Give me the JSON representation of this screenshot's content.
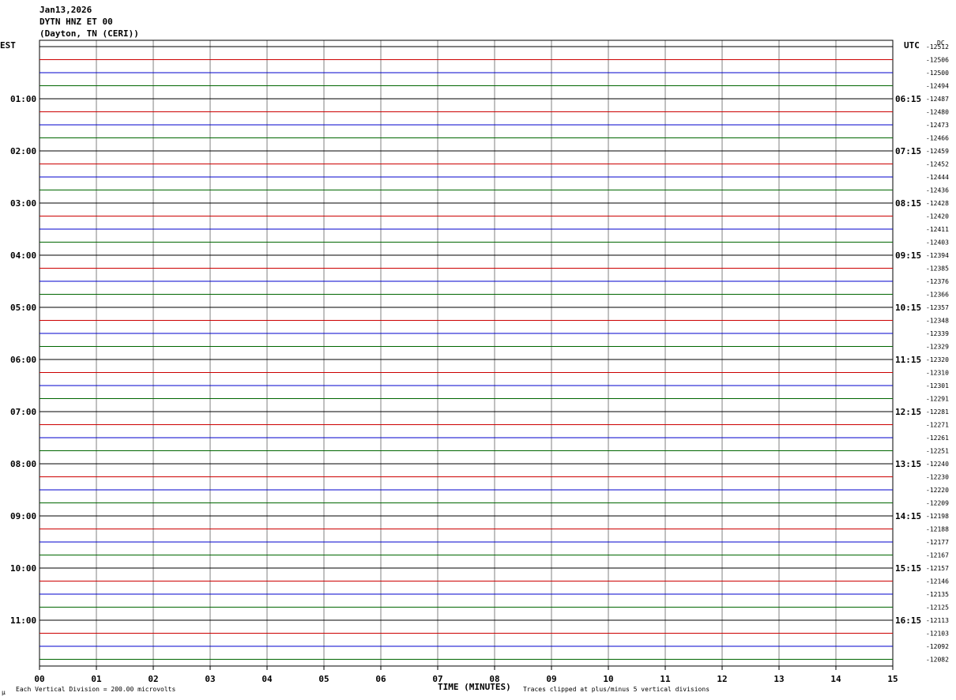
{
  "header": {
    "date": "Jan13,2026",
    "station": "DYTN HNZ ET 00",
    "location": "(Dayton, TN (CERI))"
  },
  "left_timezone": "EST",
  "right_timezone": "UTC",
  "dc_header": "DC",
  "footer": {
    "scale": "Each Vertical Division =  200.00 microvolts",
    "clip": "Traces clipped at plus/minus 5 vertical divisions",
    "corner_mark": "µ"
  },
  "colors": {
    "line_cycle": [
      "#000000",
      "#cc0000",
      "#0000cc",
      "#006600"
    ],
    "grid": "#808080",
    "frame": "#000000"
  },
  "chart_data": {
    "type": "line",
    "title": "DYTN HNZ ET 00",
    "xlabel": "TIME (MINUTES)",
    "ylabel": "",
    "xlim": [
      0,
      15
    ],
    "x_ticks": [
      "00",
      "01",
      "02",
      "03",
      "04",
      "05",
      "06",
      "07",
      "08",
      "09",
      "10",
      "11",
      "12",
      "13",
      "14",
      "15"
    ],
    "grid": true,
    "trace_count": 48,
    "left_hour_labels": [
      "01:00",
      "02:00",
      "03:00",
      "04:00",
      "05:00",
      "06:00",
      "07:00",
      "08:00",
      "09:00",
      "10:00",
      "11:00"
    ],
    "right_hour_labels": [
      "06:15",
      "07:15",
      "08:15",
      "09:15",
      "10:15",
      "11:15",
      "12:15",
      "13:15",
      "14:15",
      "15:15",
      "16:15"
    ],
    "dc_offsets": [
      -12512,
      -12506,
      -12500,
      -12494,
      -12487,
      -12480,
      -12473,
      -12466,
      -12459,
      -12452,
      -12444,
      -12436,
      -12428,
      -12420,
      -12411,
      -12403,
      -12394,
      -12385,
      -12376,
      -12366,
      -12357,
      -12348,
      -12339,
      -12329,
      -12320,
      -12310,
      -12301,
      -12291,
      -12281,
      -12271,
      -12261,
      -12251,
      -12240,
      -12230,
      -12220,
      -12209,
      -12198,
      -12188,
      -12177,
      -12167,
      -12157,
      -12146,
      -12135,
      -12125,
      -12113,
      -12103,
      -12092,
      -12082
    ]
  }
}
